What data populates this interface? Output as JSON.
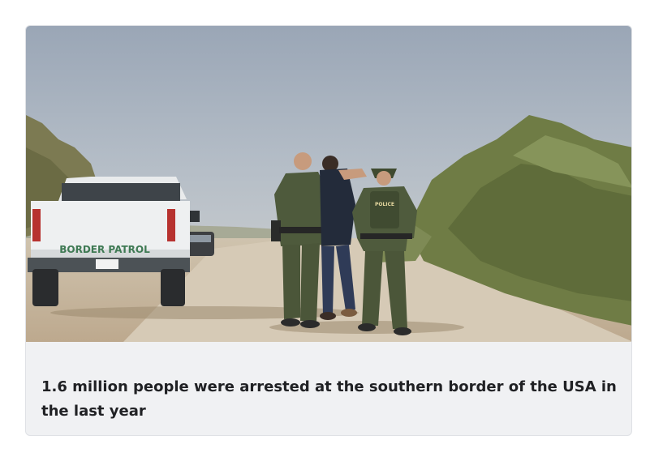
{
  "card": {
    "caption": "1.6 million people were arrested at the southern border of the USA in the last year",
    "photo": {
      "truck_text": "BORDER PATROL",
      "vest_text": "POLICE"
    }
  }
}
